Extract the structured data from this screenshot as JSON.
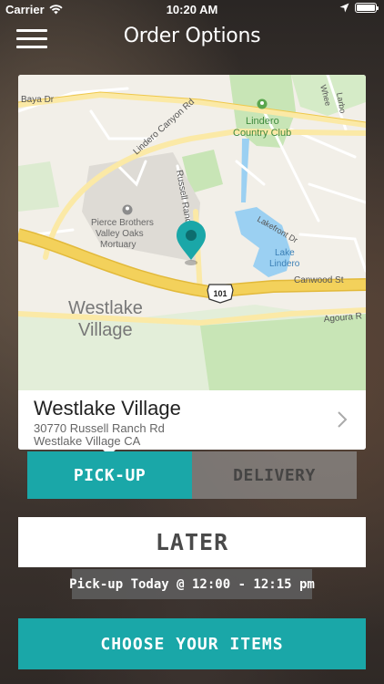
{
  "status_bar": {
    "carrier": "Carrier",
    "time": "10:20 AM",
    "battery_level": 1.0
  },
  "header": {
    "title": "Order Options",
    "menu_icon": "hamburger-menu-icon"
  },
  "map": {
    "labels": {
      "baya_dr": "Baya Dr",
      "lindero_canyon_rd": "Lindero Canyon Rd",
      "lindero_country_club": "Lindero Country Club",
      "russell_ranch": "Russell Ranch",
      "pierce_brothers": "Pierce Brothers Valley Oaks Mortuary",
      "lakefront_dr": "Lakefront Dr",
      "lake_lindero": "Lake Lindero",
      "canwood_st": "Canwood St",
      "hwy_101": "101",
      "westlake_village": "Westlake Village",
      "agoura_rd": "Agoura R",
      "wheel": "Whee",
      "larbo": "Larbo"
    },
    "pin_icon": "map-pin-icon",
    "colors": {
      "land": "#f2efe8",
      "park": "#c8e5b6",
      "freeway": "#f3d15b",
      "major_road": "#fbe9a6",
      "water": "#9bd0f2",
      "pin": "#1aa7a8"
    }
  },
  "location": {
    "name": "Westlake Village",
    "address_line1": "30770 Russell Ranch Rd",
    "address_line2": "Westlake Village CA"
  },
  "order_type": {
    "pickup_label": "PICK-UP",
    "delivery_label": "DELIVERY",
    "selected": "pickup"
  },
  "timing": {
    "later_label": "LATER",
    "pickup_time": "Pick-up Today @ 12:00 - 12:15 pm"
  },
  "cta": {
    "label": "CHOOSE YOUR ITEMS"
  },
  "colors": {
    "accent": "#1aa7a8",
    "inactive_segment": "#969696"
  }
}
